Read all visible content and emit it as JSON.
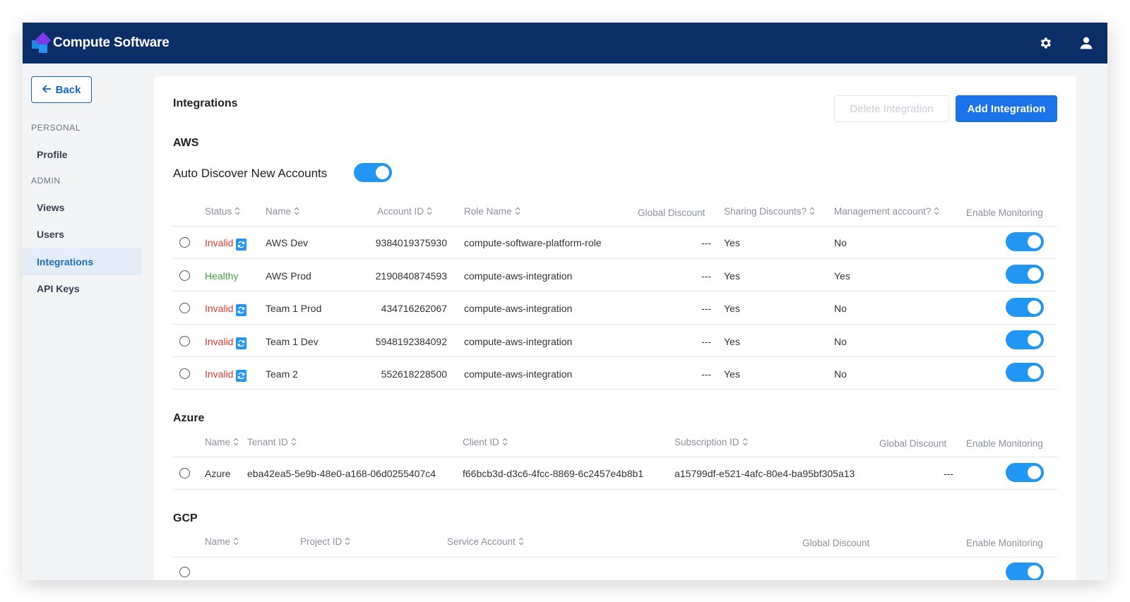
{
  "app": {
    "title": "Compute Software"
  },
  "topbar": {
    "settings_icon": "gear-icon",
    "user_icon": "user-icon"
  },
  "sidebar": {
    "back_label": "Back",
    "personal_label": "PERSONAL",
    "admin_label": "ADMIN",
    "items": [
      {
        "label": "Profile"
      },
      {
        "label": "Views"
      },
      {
        "label": "Users"
      },
      {
        "label": "Integrations",
        "active": true
      },
      {
        "label": "API Keys"
      }
    ]
  },
  "page": {
    "title": "Integrations",
    "delete_label": "Delete Integration",
    "add_label": "Add Integration"
  },
  "aws": {
    "title": "AWS",
    "auto_discover_label": "Auto Discover New Accounts",
    "auto_discover_enabled": true,
    "headers": {
      "status": "Status",
      "name": "Name",
      "account_id": "Account ID",
      "role_name": "Role Name",
      "global_discount": "Global Discount",
      "sharing": "Sharing Discounts?",
      "management": "Management account?",
      "monitoring": "Enable Monitoring"
    },
    "rows": [
      {
        "status": "Invalid",
        "name": "AWS Dev",
        "account_id": "9384019375930",
        "role": "compute-software-platform-role",
        "discount": "---",
        "sharing": "Yes",
        "management": "No",
        "monitoring": true
      },
      {
        "status": "Healthy",
        "name": "AWS Prod",
        "account_id": "2190840874593",
        "role": "compute-aws-integration",
        "discount": "---",
        "sharing": "Yes",
        "management": "Yes",
        "monitoring": true
      },
      {
        "status": "Invalid",
        "name": "Team 1 Prod",
        "account_id": "434716262067",
        "role": "compute-aws-integration",
        "discount": "---",
        "sharing": "Yes",
        "management": "No",
        "monitoring": true
      },
      {
        "status": "Invalid",
        "name": "Team 1 Dev",
        "account_id": "5948192384092",
        "role": "compute-aws-integration",
        "discount": "---",
        "sharing": "Yes",
        "management": "No",
        "monitoring": true
      },
      {
        "status": "Invalid",
        "name": "Team 2",
        "account_id": "552618228500",
        "role": "compute-aws-integration",
        "discount": "---",
        "sharing": "Yes",
        "management": "No",
        "monitoring": true
      }
    ]
  },
  "azure": {
    "title": "Azure",
    "headers": {
      "name": "Name",
      "tenant_id": "Tenant ID",
      "client_id": "Client ID",
      "subscription_id": "Subscription ID",
      "global_discount": "Global Discount",
      "monitoring": "Enable Monitoring"
    },
    "rows": [
      {
        "name": "Azure",
        "tenant_id": "eba42ea5-5e9b-48e0-a168-06d0255407c4",
        "client_id": "f66bcb3d-d3c6-4fcc-8869-6c2457e4b8b1",
        "subscription_id": "a15799df-e521-4afc-80e4-ba95bf305a13",
        "discount": "---",
        "monitoring": true
      }
    ]
  },
  "gcp": {
    "title": "GCP",
    "headers": {
      "name": "Name",
      "project_id": "Project ID",
      "service_account": "Service Account",
      "global_discount": "Global Discount",
      "monitoring": "Enable Monitoring"
    }
  },
  "colors": {
    "topbar": "#0b2e66",
    "accent": "#1a73e8",
    "invalid": "#e53935",
    "healthy": "#43a047"
  }
}
